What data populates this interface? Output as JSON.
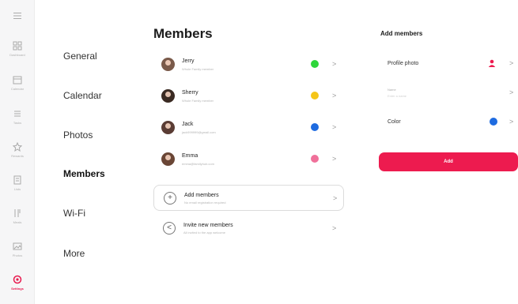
{
  "rail": {
    "items": [
      {
        "icon": "dashboard-icon",
        "label": "Dashboard"
      },
      {
        "icon": "calendar-icon",
        "label": "Calendar"
      },
      {
        "icon": "tasks-icon",
        "label": "Tasks"
      },
      {
        "icon": "rewards-icon",
        "label": "Rewards"
      },
      {
        "icon": "lists-icon",
        "label": "Lists"
      },
      {
        "icon": "meals-icon",
        "label": "Meals"
      },
      {
        "icon": "photos-icon",
        "label": "Photos"
      },
      {
        "icon": "settings-icon",
        "label": "Settings"
      }
    ]
  },
  "categories": [
    "General",
    "Calendar",
    "Photos",
    "Members",
    "Wi-Fi",
    "More"
  ],
  "members_panel": {
    "title": "Members",
    "members": [
      {
        "name": "Jerry",
        "subtitle": "Whole Family member",
        "color": "#2ed63a"
      },
      {
        "name": "Sherry",
        "subtitle": "Whole Family member",
        "color": "#f5c518"
      },
      {
        "name": "Jack",
        "subtitle": "jack999999@gmail.com",
        "color": "#1e6be0"
      },
      {
        "name": "Emma",
        "subtitle": "emma@familyhub.com",
        "color": "#f0709a"
      }
    ],
    "add_members": {
      "label": "Add members",
      "subtitle": "No email registration required"
    },
    "invite_members": {
      "label": "Invite new members",
      "subtitle": "All invited to the app welcome"
    }
  },
  "add_panel": {
    "title": "Add members",
    "profile_photo_label": "Profile photo",
    "name_label": "Name",
    "name_placeholder": "Enter a name",
    "color_label": "Color",
    "color_value": "#1e6be0",
    "add_button": "Add"
  },
  "colors": {
    "accent": "#ed1b4f"
  }
}
